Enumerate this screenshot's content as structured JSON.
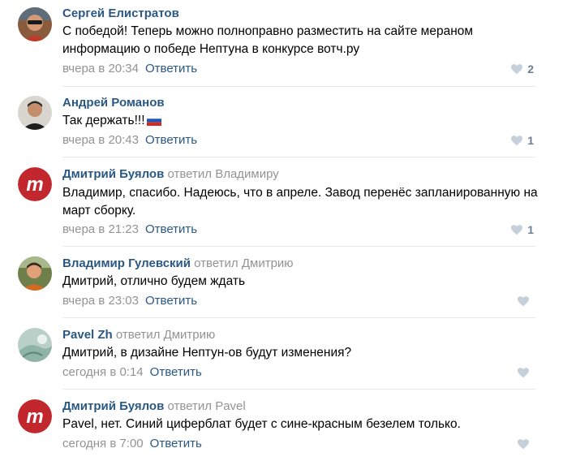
{
  "comments": [
    {
      "author": "Сергей Елистратов",
      "replied": "",
      "reply_to": "",
      "text": "С победой! Теперь можно полноправно разместить на сайте мераном информацию о победе Нептуна в конкурсе вотч.ру",
      "date": "вчера в 20:34",
      "reply_label": "Ответить",
      "likes": "2"
    },
    {
      "author": "Андрей Романов",
      "replied": "",
      "reply_to": "",
      "text": "Так держать!!!",
      "date": "вчера в 20:43",
      "reply_label": "Ответить",
      "likes": "1"
    },
    {
      "author": "Дмитрий Буялов",
      "replied": "ответил",
      "reply_to": "Владимиру",
      "text": "Владимир, спасибо. Надеюсь, что в апреле. Завод перенёс запланированную на март сборку.",
      "date": "вчера в 21:23",
      "reply_label": "Ответить",
      "likes": "1"
    },
    {
      "author": "Владимир Гулевский",
      "replied": "ответил",
      "reply_to": "Дмитрию",
      "text": "Дмитрий, отлично будем ждать",
      "date": "вчера в 23:03",
      "reply_label": "Ответить",
      "likes": ""
    },
    {
      "author": "Pavel Zh",
      "replied": "ответил",
      "reply_to": "Дмитрию",
      "text": "Дмитрий, в дизайне Нептун-ов будут изменения?",
      "date": "сегодня в 0:14",
      "reply_label": "Ответить",
      "likes": ""
    },
    {
      "author": "Дмитрий Буялов",
      "replied": "ответил",
      "reply_to": "Pavel",
      "text": "Pavel, нет. Синий циферблат будет с сине-красным безелем только.",
      "date": "сегодня в 7:00",
      "reply_label": "Ответить",
      "likes": ""
    }
  ],
  "icons": {
    "like": "heart-icon",
    "flag": "russia-flag-icon"
  },
  "colors": {
    "author": "#2a5885",
    "muted": "#939393",
    "heart": "#c5d0db",
    "divider": "#e7e8ec",
    "logo": "#c1272d"
  }
}
